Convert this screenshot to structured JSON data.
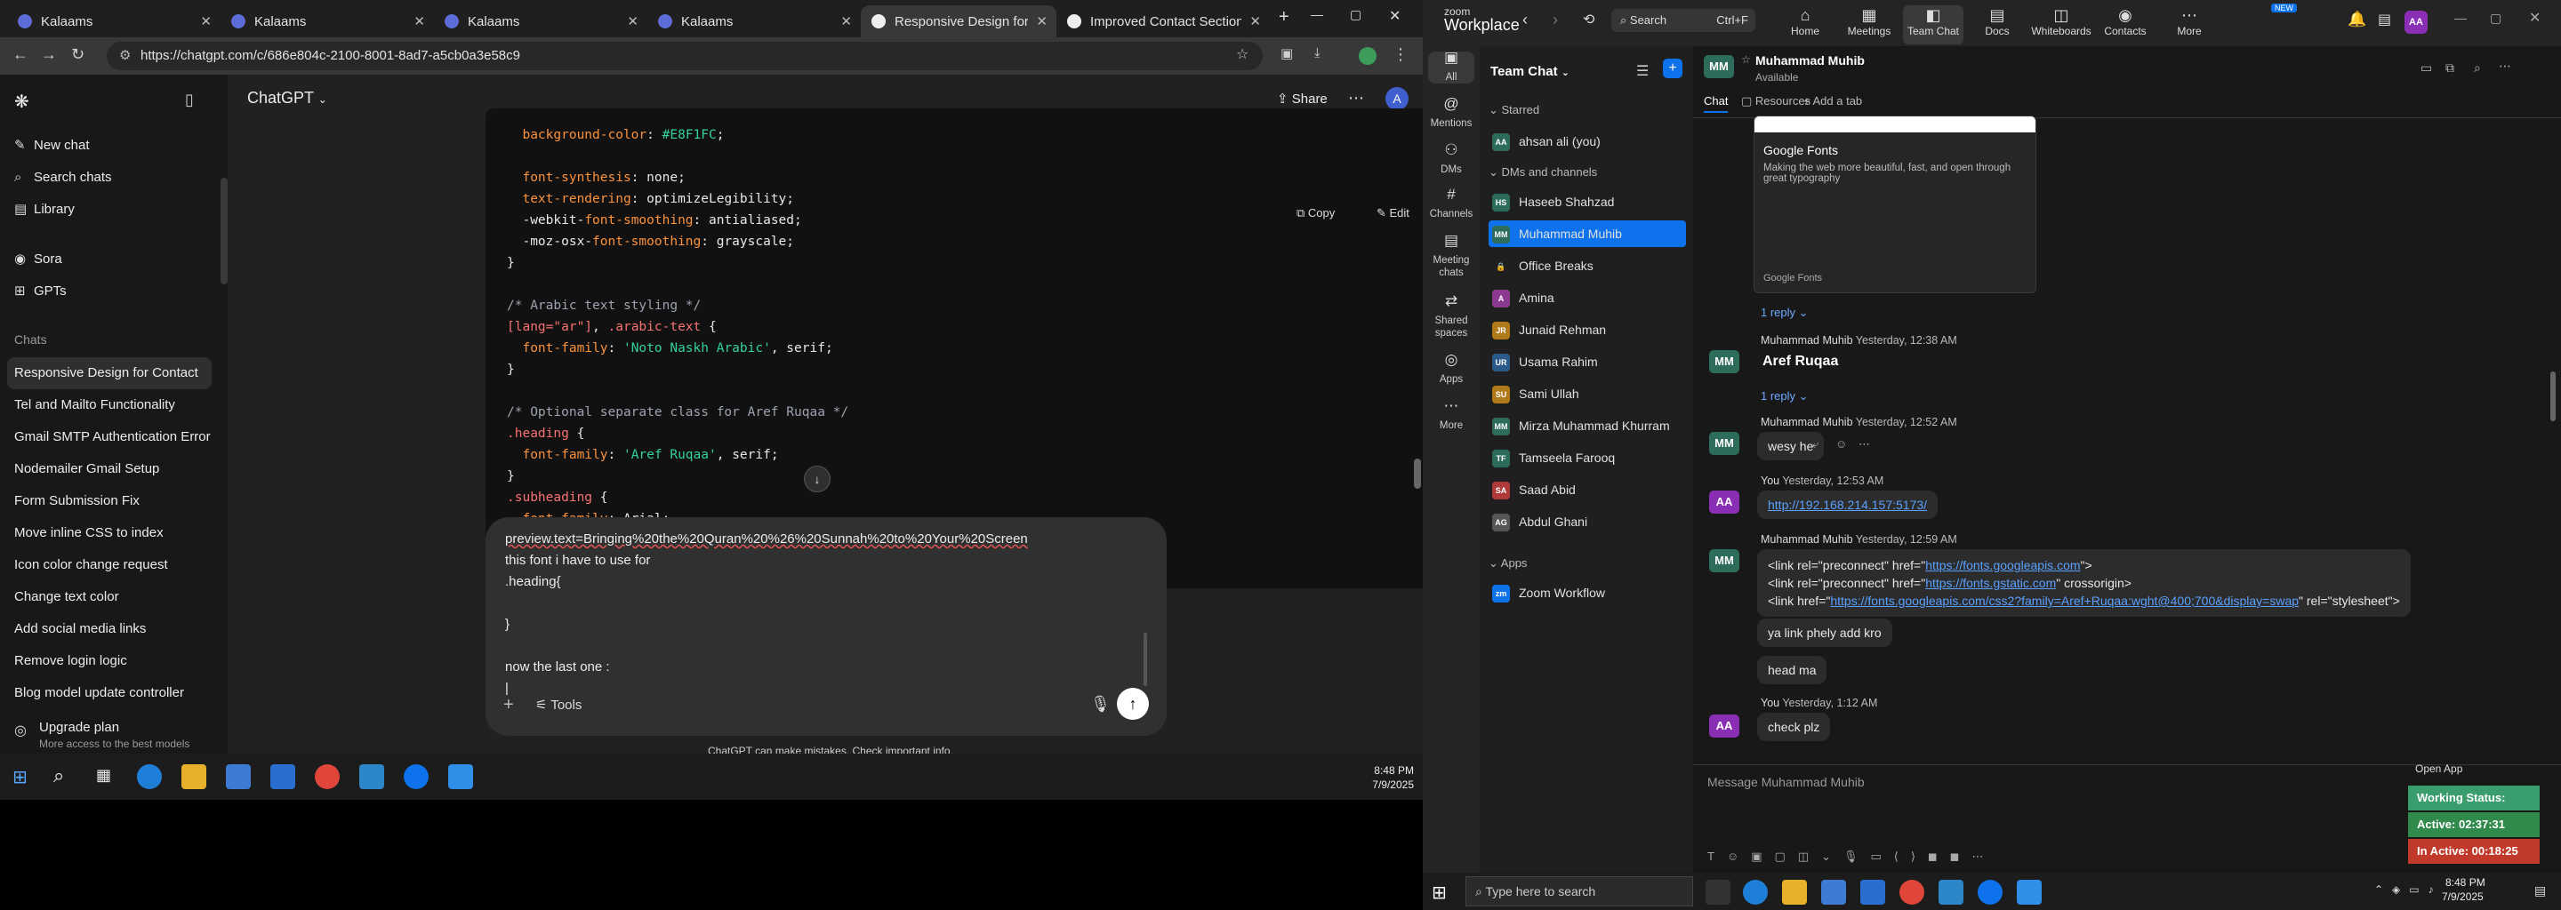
{
  "chrome": {
    "tabs": [
      "Kalaams",
      "Kalaams",
      "Kalaams",
      "Kalaams",
      "Responsive Design for Conta",
      "Improved Contact Section S"
    ],
    "url": "https://chatgpt.com/c/686e804c-2100-8001-8ad7-a5cb0a3e58c9",
    "new_tab": "+"
  },
  "gpt": {
    "title": "ChatGPT",
    "share": "Share",
    "copy": "Copy",
    "edit": "Edit",
    "avatar": "A",
    "menu": [
      {
        "icon": "✎",
        "label": "New chat"
      },
      {
        "icon": "⌕",
        "label": "Search chats"
      },
      {
        "icon": "▤",
        "label": "Library"
      },
      {
        "icon": "◉",
        "label": "Sora"
      },
      {
        "icon": "⊞",
        "label": "GPTs"
      }
    ],
    "chats_label": "Chats",
    "chats": [
      "Responsive Design for Contact",
      "Tel and Mailto Functionality",
      "Gmail SMTP Authentication Error",
      "Nodemailer Gmail Setup",
      "Form Submission Fix",
      "Move inline CSS to index",
      "Icon color change request",
      "Change text color",
      "Add social media links",
      "Remove login logic",
      "Blog model update controller"
    ],
    "upgrade_title": "Upgrade plan",
    "upgrade_sub": "More access to the best models",
    "code_lines": [
      [
        [
          "p",
          "  "
        ],
        [
          "sel",
          "background-color"
        ],
        [
          "p",
          ": "
        ],
        [
          "s",
          "#E8F1FC"
        ],
        [
          "p",
          ";"
        ]
      ],
      [
        [
          "p",
          ""
        ]
      ],
      [
        [
          "p",
          "  "
        ],
        [
          "sel",
          "font-synthesis"
        ],
        [
          "p",
          ": none;"
        ]
      ],
      [
        [
          "p",
          "  "
        ],
        [
          "sel",
          "text-rendering"
        ],
        [
          "p",
          ": optimizeLegibility;"
        ]
      ],
      [
        [
          "p",
          "  -webkit-"
        ],
        [
          "sel",
          "font-smoothing"
        ],
        [
          "p",
          ": antialiased;"
        ]
      ],
      [
        [
          "p",
          "  -moz-osx-"
        ],
        [
          "sel",
          "font-smoothing"
        ],
        [
          "p",
          ": grayscale;"
        ]
      ],
      [
        [
          "p",
          "}"
        ]
      ],
      [
        [
          "p",
          ""
        ]
      ],
      [
        [
          "c",
          "/* Arabic text styling */"
        ]
      ],
      [
        [
          "k",
          "[lang=\"ar\"]"
        ],
        [
          "p",
          ", "
        ],
        [
          "k",
          ".arabic-text"
        ],
        [
          "p",
          " {"
        ]
      ],
      [
        [
          "p",
          "  "
        ],
        [
          "sel",
          "font-family"
        ],
        [
          "p",
          ": "
        ],
        [
          "s",
          "'Noto Naskh Arabic'"
        ],
        [
          "p",
          ", serif;"
        ]
      ],
      [
        [
          "p",
          "}"
        ]
      ],
      [
        [
          "p",
          ""
        ]
      ],
      [
        [
          "c",
          "/* Optional separate class for Aref Ruqaa */"
        ]
      ],
      [
        [
          "k",
          ".heading"
        ],
        [
          "p",
          " {"
        ]
      ],
      [
        [
          "p",
          "  "
        ],
        [
          "sel",
          "font-family"
        ],
        [
          "p",
          ": "
        ],
        [
          "s",
          "'Aref Ruqaa'"
        ],
        [
          "p",
          ", serif;"
        ]
      ],
      [
        [
          "p",
          "}"
        ]
      ],
      [
        [
          "k",
          ".subheading"
        ],
        [
          "p",
          " {"
        ]
      ],
      [
        [
          "p",
          "  "
        ],
        [
          "sel",
          "font-family"
        ],
        [
          "p",
          ": Arial;"
        ]
      ]
    ],
    "composer_lines": [
      "preview.text=Bringing%20the%20Quran%20%26%20Sunnah%20to%20Your%20Screen",
      "this font i have to use for",
      ".heading{",
      "",
      "}",
      "",
      "now the last one :",
      "|"
    ],
    "tools": "Tools",
    "disclaimer": "ChatGPT can make mistakes. Check important info."
  },
  "taskbar_left": {
    "time": "8:48 PM",
    "date": "7/9/2025"
  },
  "zoom": {
    "logo1": "zoom",
    "logo2": "Workplace",
    "search": "Search",
    "shortcut": "Ctrl+F",
    "nav": [
      "Home",
      "Meetings",
      "Team Chat",
      "Docs",
      "Whiteboards",
      "Contacts",
      "More"
    ],
    "new_badge": "NEW",
    "user_initials": "AA",
    "rail": [
      "All",
      "Mentions",
      "DMs",
      "Channels",
      "Meeting chats",
      "Shared spaces",
      "Apps",
      "More"
    ],
    "team_chat_title": "Team Chat",
    "starred_label": "Starred",
    "starred": [
      {
        "initials": "AA",
        "name": "ahsan ali (you)",
        "color": "#2d6b5a"
      }
    ],
    "dms_label": "DMs and channels",
    "dms": [
      {
        "initials": "HS",
        "name": "Haseeb Shahzad",
        "color": "#2d6b5a"
      },
      {
        "initials": "MM",
        "name": "Muhammad Muhib",
        "color": "#2d6b5a"
      },
      {
        "initials": "🔒",
        "name": "Office Breaks",
        "color": "#1f1f1f"
      },
      {
        "initials": "A",
        "name": "Amina",
        "color": "#8a3b8f"
      },
      {
        "initials": "JR",
        "name": "Junaid Rehman",
        "color": "#b07a18"
      },
      {
        "initials": "UR",
        "name": "Usama Rahim",
        "color": "#2b5a8a"
      },
      {
        "initials": "SU",
        "name": "Sami Ullah",
        "color": "#b07a18"
      },
      {
        "initials": "MM",
        "name": "Mirza Muhammad Khurram",
        "color": "#2d6b5a"
      },
      {
        "initials": "TF",
        "name": "Tamseela Farooq",
        "color": "#2d6b5a"
      },
      {
        "initials": "SA",
        "name": "Saad Abid",
        "color": "#b03a3a"
      },
      {
        "initials": "AG",
        "name": "Abdul Ghani",
        "color": "#555555"
      }
    ],
    "apps_label": "Apps",
    "apps": [
      {
        "initials": "zm",
        "name": "Zoom Workflow",
        "color": "#0e72ed"
      }
    ],
    "chat_header_name": "Muhammad Muhib",
    "chat_header_status": "Available",
    "chat_tabs": [
      "Chat",
      "Resources",
      "Add a tab"
    ],
    "gf_title": "Google Fonts",
    "gf_desc": "Making the web more beautiful, fast, and open through great typography",
    "gf_footer": "Google Fonts",
    "reply1": "1 reply",
    "m1_name": "Muhammad Muhib",
    "m1_time": "Yesterday, 12:38 AM",
    "m1_text": "Aref Ruqaa",
    "reply2": "1 reply",
    "m2_name": "Muhammad Muhib",
    "m2_time": "Yesterday, 12:52 AM",
    "m2_text": "wesy he",
    "m3_name": "You",
    "m3_time": "Yesterday, 12:53 AM",
    "m3_text": "http://192.168.214.157:5173/",
    "m4_name": "Muhammad Muhib",
    "m4_time": "Yesterday, 12:59 AM",
    "m4_l1a": "<link rel=\"preconnect\" href=\"",
    "m4_l1b": "https://fonts.googleapis.com",
    "m4_l1c": "\">",
    "m4_l2a": "<link rel=\"preconnect\" href=\"",
    "m4_l2b": "https://fonts.gstatic.com",
    "m4_l2c": "\" crossorigin>",
    "m4_l3a": "<link href=\"",
    "m4_l3b": "https://fonts.googleapis.com/css2?family=Aref+Ruqaa:wght@400;700&display=swap",
    "m4_l3c": "\" rel=\"stylesheet\">",
    "m5_text": "ya link phely add kro",
    "m6_text": "head ma",
    "m7_name": "You",
    "m7_time": "Yesterday, 1:12 AM",
    "m7_text": "check plz",
    "compose_placeholder": "Message Muhammad Muhib",
    "open_app": "Open App",
    "status_working": "Working Status: Active",
    "status_active": "Active: 02:37:31",
    "status_inactive": "In Active: 00:18:25",
    "search_windows": "Type here to search",
    "time": "8:48 PM",
    "date": "7/9/2025"
  }
}
